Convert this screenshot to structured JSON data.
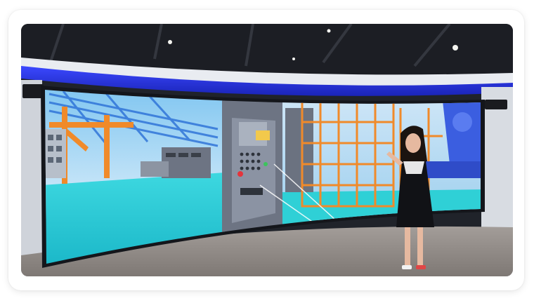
{
  "scene": {
    "ceiling_icon": "ceiling-spotlight-icon",
    "speaker_icon": "wall-speaker-icon",
    "person_icon": "standing-person-icon"
  },
  "colors": {
    "ceiling": "#1c1e24",
    "led_strip": "#2b38e6",
    "wall": "#dfe3ea",
    "floor": "#8f8a86",
    "screen_sky": "#6fb6e8",
    "screen_floor": "#20c8d8",
    "scaffold": "#f08a2a",
    "panel": "#6d7483"
  }
}
